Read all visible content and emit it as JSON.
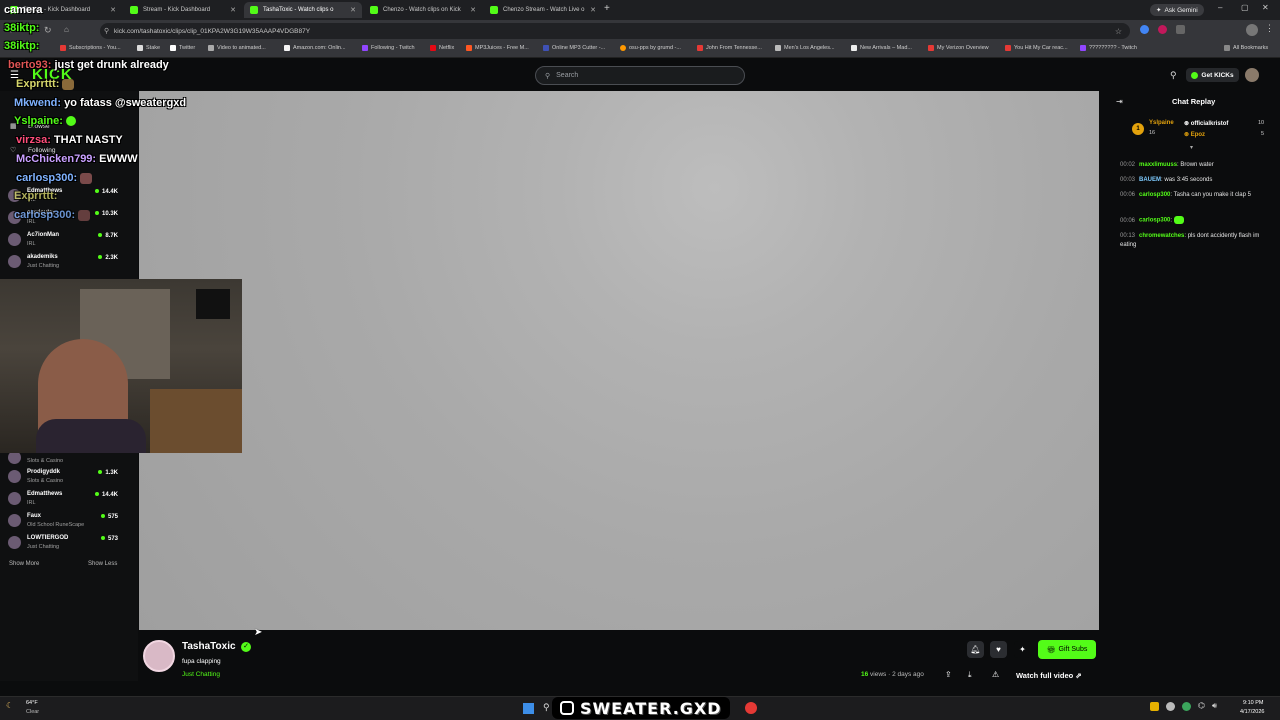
{
  "browser": {
    "tabs": [
      {
        "label": "Stream - Kick Dashboard",
        "active": false
      },
      {
        "label": "Stream - Kick Dashboard",
        "active": false
      },
      {
        "label": "TashaToxic - Watch clips o",
        "active": true
      },
      {
        "label": "Chenzo - Watch clips on Kick",
        "active": false
      },
      {
        "label": "Chenzo Stream - Watch Live o",
        "active": false
      }
    ],
    "ask_gemini": "Ask Gemini",
    "url": "kick.com/tashatoxic/clips/clip_01KPA2W3G19W35AAAP4VDGB87Y",
    "bookmarks": [
      "Subscriptions - You...",
      "Stake",
      "Twitter",
      "Video to animated...",
      "Amazon.com: Onlin...",
      "Following - Twitch",
      "Netflix",
      "MP3Juices - Free M...",
      "Online MP3 Cutter -...",
      "osu-pps by grumd -...",
      "John From Tennesse...",
      "Men's Los Angeles...",
      "New Arrivals – Mad...",
      "My Verizon Overview",
      "You Hit My Car reac...",
      "????????? - Twitch"
    ],
    "all_bookmarks": "All Bookmarks"
  },
  "kick": {
    "logo": "KICK",
    "search_placeholder": "Search",
    "get_kicks": "Get KICKs",
    "sidebar": {
      "browse": "Browse",
      "following": "Following",
      "channels": [
        {
          "name": "Edmatthews",
          "category": "IRL",
          "viewers": "14.4K"
        },
        {
          "name": "clavicular",
          "category": "IRL",
          "viewers": "10.3K"
        },
        {
          "name": "Ac7ionMan",
          "category": "IRL",
          "viewers": "8.7K"
        },
        {
          "name": "akademiks",
          "category": "Just Chatting",
          "viewers": "2.3K"
        }
      ],
      "channels_lower": [
        {
          "name": "",
          "category": "Slots & Casino",
          "viewers": ""
        },
        {
          "name": "Prodigyddk",
          "category": "Slots & Casino",
          "viewers": "1.3K"
        },
        {
          "name": "Edmatthews",
          "category": "IRL",
          "viewers": "14.4K"
        },
        {
          "name": "Faux",
          "category": "Old School RuneScape",
          "viewers": "575"
        },
        {
          "name": "LOWTIERGOD",
          "category": "Just Chatting",
          "viewers": "573"
        }
      ],
      "show_more": "Show More",
      "show_less": "Show Less"
    },
    "chat": {
      "title": "Chat Replay",
      "gifters": [
        {
          "name": "Yslpaine",
          "count": "16"
        },
        {
          "name": "officialkristof",
          "count": "10"
        },
        {
          "name": "Epoz",
          "count": "5"
        }
      ],
      "messages": [
        {
          "time": "00:02",
          "user": "maxxlimuuss",
          "text": "Brown water"
        },
        {
          "time": "00:03",
          "user": "BAUEM",
          "text": "was 3:45 seconds"
        },
        {
          "time": "00:06",
          "user": "carlosp300",
          "text": "Tasha can you make it clap 5"
        },
        {
          "time": "00:06",
          "user": "carlosp300",
          "text": ""
        },
        {
          "time": "00:13",
          "user": "chromewatches",
          "text": "pls dont accidently flash im eating"
        }
      ]
    },
    "clip": {
      "streamer": "TashaToxic",
      "title": "fupa clapping",
      "category": "Just Chatting",
      "views": "16",
      "views_label": "views",
      "age": "2 days ago",
      "gift_subs": "Gift Subs",
      "watch_full": "Watch full video"
    }
  },
  "overlay": {
    "camera_label": "camera",
    "chat_lines": [
      {
        "user": "38iktp:",
        "text": ""
      },
      {
        "user": "38iktp:",
        "text": ""
      },
      {
        "user": "berto93:",
        "text": "just get drunk already"
      },
      {
        "user": "Exprrttt:",
        "text": ""
      },
      {
        "user": "Mkwend:",
        "text": "yo fatass @sweatergxd"
      },
      {
        "user": "Yslpaine:",
        "text": ""
      },
      {
        "user": "virzsa:",
        "text": "THAT NASTY"
      },
      {
        "user": "McChicken799:",
        "text": "EWWW"
      },
      {
        "user": "carlosp300:",
        "text": ""
      },
      {
        "user": "Exprrttt:",
        "text": ""
      },
      {
        "user": "carlosp300:",
        "text": ""
      }
    ],
    "watermark": "SWEATER.GXD"
  },
  "taskbar": {
    "weather_temp": "64°F",
    "weather_desc": "Clear",
    "time": "9:10 PM",
    "date": "4/17/2026"
  }
}
